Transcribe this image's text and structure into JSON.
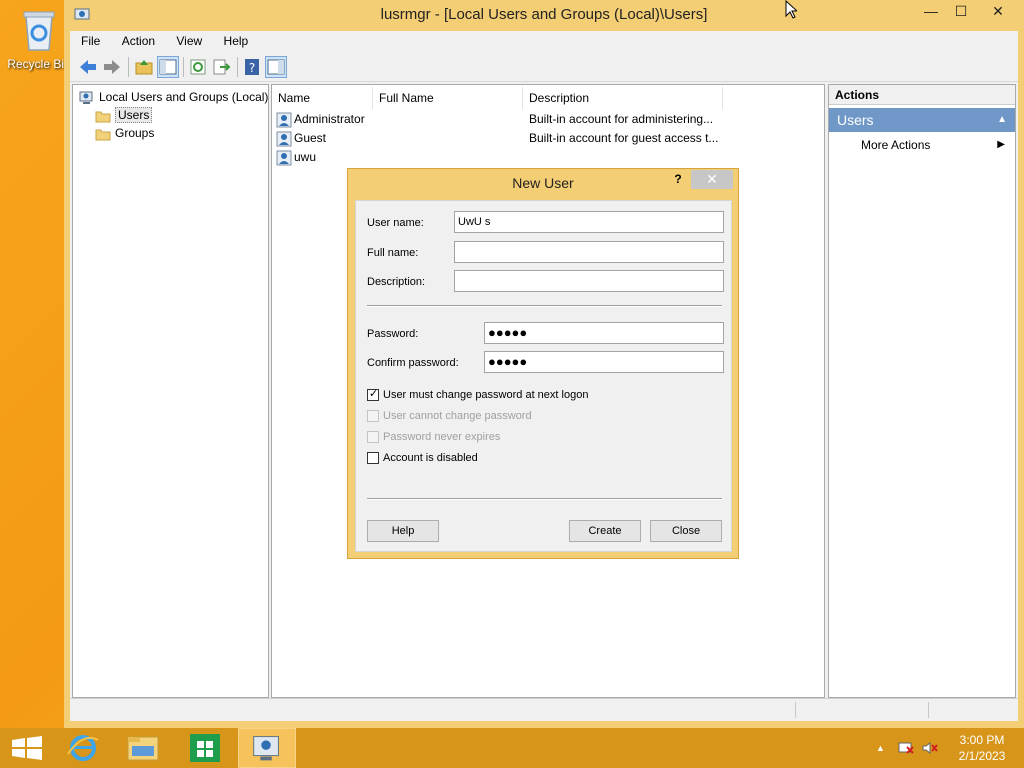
{
  "desktop": {
    "recycle_label": "Recycle Bin"
  },
  "window": {
    "title": "lusrmgr - [Local Users and Groups (Local)\\Users]",
    "controls": {
      "minimize": "—",
      "maximize": "☐",
      "close": "✕"
    }
  },
  "menu": [
    "File",
    "Action",
    "View",
    "Help"
  ],
  "tree": {
    "root": "Local Users and Groups (Local)",
    "children": [
      "Users",
      "Groups"
    ]
  },
  "list": {
    "columns": [
      "Name",
      "Full Name",
      "Description"
    ],
    "rows": [
      {
        "name": "Administrator",
        "full_name": "",
        "description": "Built-in account for administering..."
      },
      {
        "name": "Guest",
        "full_name": "",
        "description": "Built-in account for guest access t..."
      },
      {
        "name": "uwu",
        "full_name": "",
        "description": ""
      }
    ]
  },
  "actions": {
    "header": "Actions",
    "section": "Users",
    "more": "More Actions"
  },
  "dialog": {
    "title": "New User",
    "help_glyph": "?",
    "close_glyph": "✕",
    "username_label": "User name:",
    "username_value": "UwU s",
    "fullname_label": "Full name:",
    "fullname_value": "",
    "description_label": "Description:",
    "description_value": "",
    "password_label": "Password:",
    "password_value": "●●●●●",
    "confirm_label": "Confirm password:",
    "confirm_value": "●●●●●",
    "checks": [
      {
        "label": "User must change password at next logon",
        "checked": true,
        "enabled": true
      },
      {
        "label": "User cannot change password",
        "checked": false,
        "enabled": false
      },
      {
        "label": "Password never expires",
        "checked": false,
        "enabled": false
      },
      {
        "label": "Account is disabled",
        "checked": false,
        "enabled": true
      }
    ],
    "help_button": "Help",
    "create_button": "Create",
    "close_button": "Close"
  },
  "taskbar": {
    "time": "3:00 PM",
    "date": "2/1/2023"
  }
}
